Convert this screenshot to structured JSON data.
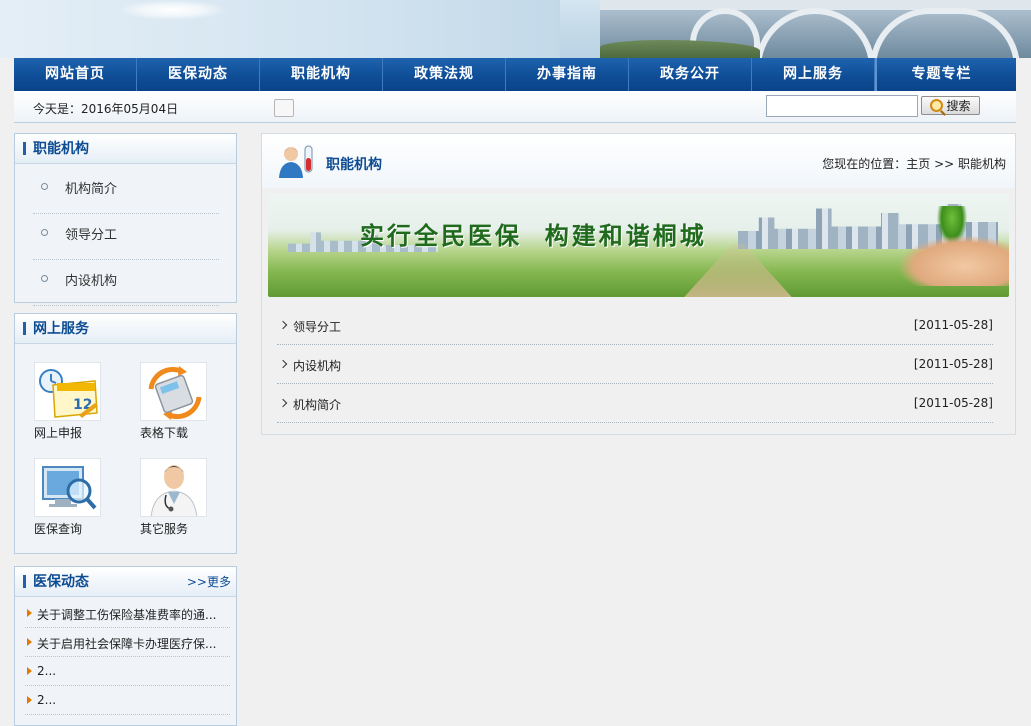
{
  "nav": {
    "items": [
      "网站首页",
      "医保动态",
      "职能机构",
      "政策法规",
      "办事指南",
      "政务公开",
      "网上服务",
      "专题专栏"
    ]
  },
  "infobar": {
    "date_text": "今天是：2016年05月04日",
    "search_value": "",
    "search_button": "搜索"
  },
  "sidebar": {
    "org": {
      "title": "职能机构",
      "items": [
        "机构简介",
        "领导分工",
        "内设机构"
      ]
    },
    "services": {
      "title": "网上服务",
      "items": [
        {
          "label": "网上申报",
          "icon": "calendar-icon"
        },
        {
          "label": "表格下载",
          "icon": "calculator-icon"
        },
        {
          "label": "医保查询",
          "icon": "monitor-search-icon"
        },
        {
          "label": "其它服务",
          "icon": "doctor-icon"
        }
      ]
    },
    "news": {
      "title": "医保动态",
      "more": ">>更多",
      "items": [
        "关于调整工伤保险基准费率的通...",
        "关于启用社会保障卡办理医疗保...",
        "2...",
        "2..."
      ]
    }
  },
  "main": {
    "title": "职能机构",
    "breadcrumb": "您现在的位置：主页 >> 职能机构",
    "banner_slogan": "实行全民医保  构建和谐桐城",
    "list": [
      {
        "title": "领导分工",
        "date": "[2011-05-28]"
      },
      {
        "title": "内设机构",
        "date": "[2011-05-28]"
      },
      {
        "title": "机构简介",
        "date": "[2011-05-28]"
      }
    ]
  },
  "colors": {
    "nav_blue": "#0f4e97",
    "heading_blue": "#0d4c93",
    "news_arrow": "#e07a00"
  }
}
